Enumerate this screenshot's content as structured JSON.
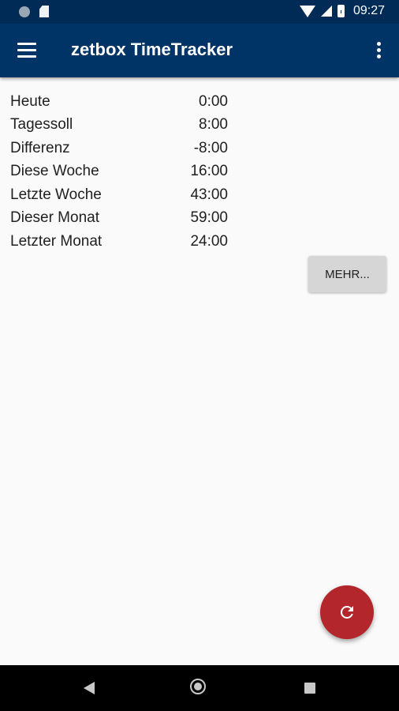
{
  "status_bar": {
    "time": "09:27"
  },
  "app_bar": {
    "title": "zetbox TimeTracker"
  },
  "stats": [
    {
      "label": "Heute",
      "value": "0:00"
    },
    {
      "label": "Tagessoll",
      "value": "8:00"
    },
    {
      "label": "Differenz",
      "value": "-8:00"
    },
    {
      "label": "Diese Woche",
      "value": "16:00"
    },
    {
      "label": "Letzte Woche",
      "value": "43:00"
    },
    {
      "label": "Dieser Monat",
      "value": "59:00"
    },
    {
      "label": "Letzter Monat",
      "value": "24:00"
    }
  ],
  "more_button": {
    "label": "MEHR..."
  },
  "fab": {
    "icon": "refresh-icon",
    "color": "#b3262c"
  },
  "colors": {
    "app_bar": "#003466",
    "status_bar": "#002b57",
    "background": "#fafafa"
  },
  "nav_bar": {
    "icons": [
      "back-icon",
      "home-icon",
      "recents-icon"
    ]
  }
}
